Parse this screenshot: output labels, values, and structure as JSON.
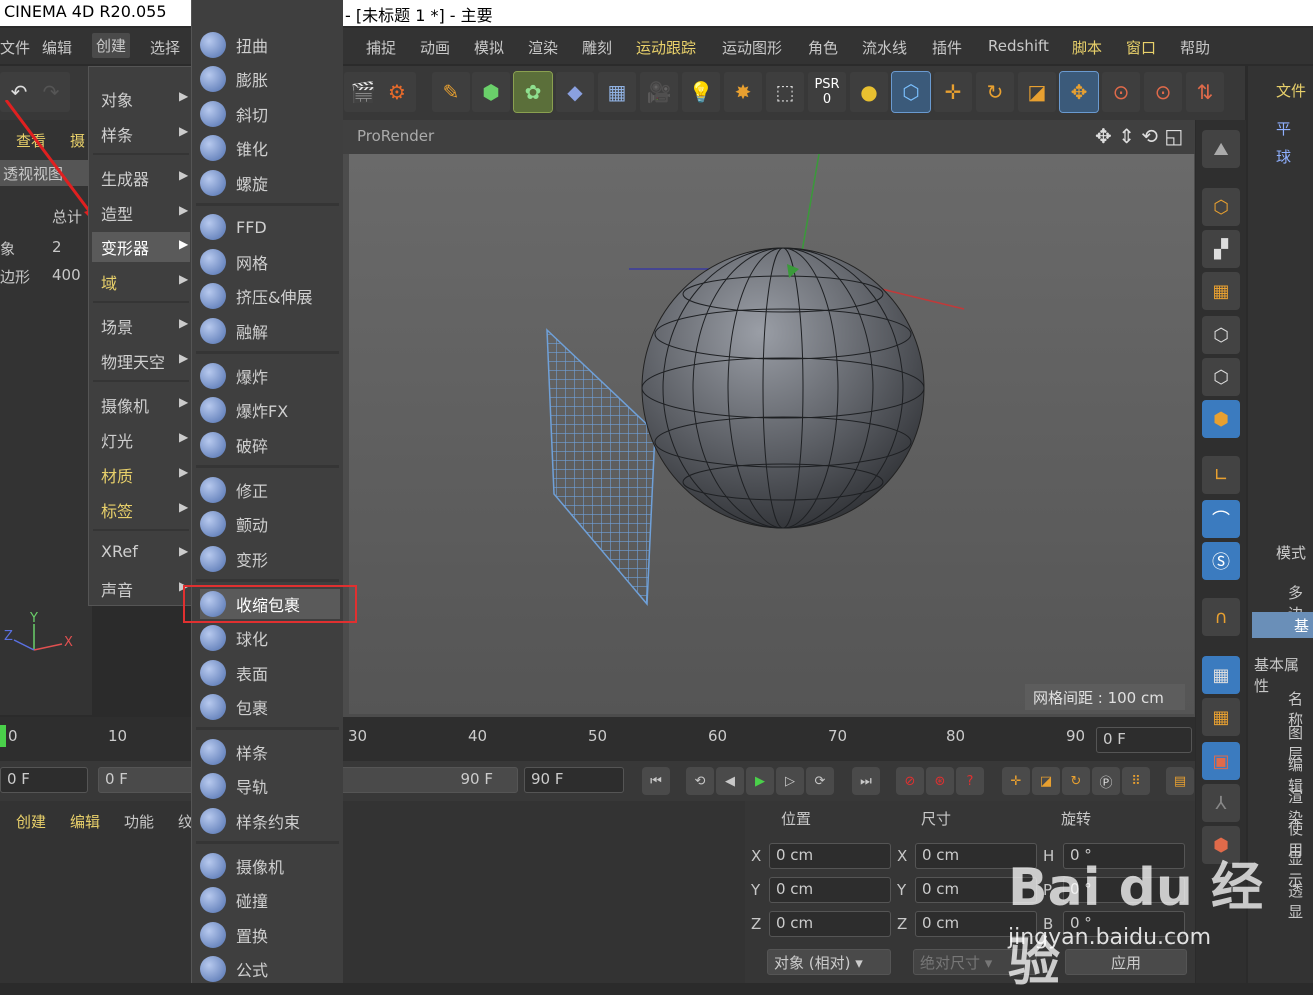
{
  "title": {
    "left": "CINEMA 4D R20.055",
    "right": "- [未标题 1 *] - 主要"
  },
  "menubar": [
    "文件",
    "编辑",
    "创建",
    "选择",
    "捕捉",
    "动画",
    "模拟",
    "渲染",
    "雕刻",
    "运动跟踪",
    "运动图形",
    "角色",
    "流水线",
    "插件",
    "Redshift",
    "脚本",
    "窗口",
    "帮助"
  ],
  "toolbar": {
    "psr": "PSR",
    "psr_value": "0"
  },
  "leftpanel": {
    "tabs": [
      "查看",
      "摄"
    ],
    "view_label": "透视视图",
    "stats_header": "总计",
    "rows": [
      {
        "label": "象",
        "value": "2"
      },
      {
        "label": "边形",
        "value": "400"
      }
    ]
  },
  "viewport": {
    "renderer": "ProRender",
    "grid_spacing": "网格间距 : 100 cm"
  },
  "menu1": {
    "items": [
      "对象",
      "样条",
      "生成器",
      "造型",
      "变形器",
      "域",
      "场景",
      "物理天空",
      "摄像机",
      "灯光",
      "材质",
      "标签",
      "XRef",
      "声音"
    ],
    "selected": "变形器"
  },
  "menu2": {
    "items": [
      "扭曲",
      "膨胀",
      "斜切",
      "锥化",
      "螺旋",
      "FFD",
      "网格",
      "挤压&伸展",
      "融解",
      "爆炸",
      "爆炸FX",
      "破碎",
      "修正",
      "颤动",
      "变形",
      "收缩包裹",
      "球化",
      "表面",
      "包裹",
      "样条",
      "导轨",
      "样条约束",
      "摄像机",
      "碰撞",
      "置换",
      "公式"
    ],
    "highlighted": "收缩包裹"
  },
  "timeline": {
    "ticks": [
      "0",
      "10",
      "30",
      "40",
      "50",
      "60",
      "70",
      "80",
      "90"
    ],
    "frame_field": "0 F"
  },
  "transport": {
    "start": "0 F",
    "range_start": "0 F",
    "range_end": "90 F",
    "end": "90 F"
  },
  "bottom": {
    "menu": [
      "创建",
      "编辑",
      "功能",
      "纹"
    ]
  },
  "coords": {
    "headers": [
      "位置",
      "尺寸",
      "旋转"
    ],
    "x": "0 cm",
    "y": "0 cm",
    "z": "0 cm",
    "sx": "0 cm",
    "sy": "0 cm",
    "sz": "0 cm",
    "h": "0 °",
    "p": "0 °",
    "b": "0 °",
    "mode": "对象 (相对)",
    "size_mode": "绝对尺寸",
    "apply": "应用"
  },
  "objpanel": {
    "header": "文件",
    "items": [
      "平",
      "球"
    ]
  },
  "attrpanel": {
    "header": "模式",
    "obj": "多边",
    "tab": "基",
    "section": "基本属性",
    "rows": [
      "名称",
      "图层",
      "编辑",
      "渲染",
      "使用",
      "显示",
      "透显"
    ]
  },
  "watermark": {
    "logo": "Bai du 经验",
    "url": "jingyan.baidu.com"
  }
}
